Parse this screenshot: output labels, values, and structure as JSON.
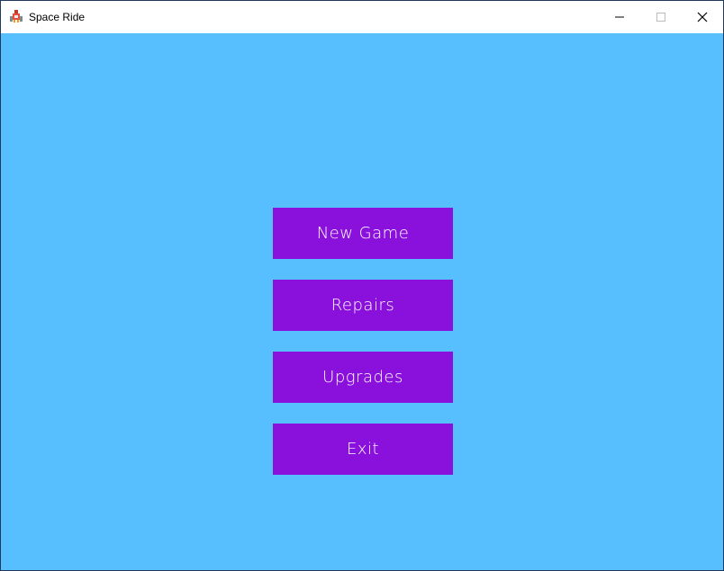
{
  "window": {
    "title": "Space Ride",
    "app_icon": "spaceship-icon",
    "controls": {
      "minimize_icon": "minimize-icon",
      "maximize_icon": "maximize-icon",
      "close_icon": "close-icon"
    }
  },
  "colors": {
    "background": "#58bfff",
    "button": "#8a10dc",
    "button_text": "#ffffff",
    "titlebar": "#ffffff"
  },
  "menu": {
    "new_game_label": "New Game",
    "repairs_label": "Repairs",
    "upgrades_label": "Upgrades",
    "exit_label": "Exit"
  }
}
